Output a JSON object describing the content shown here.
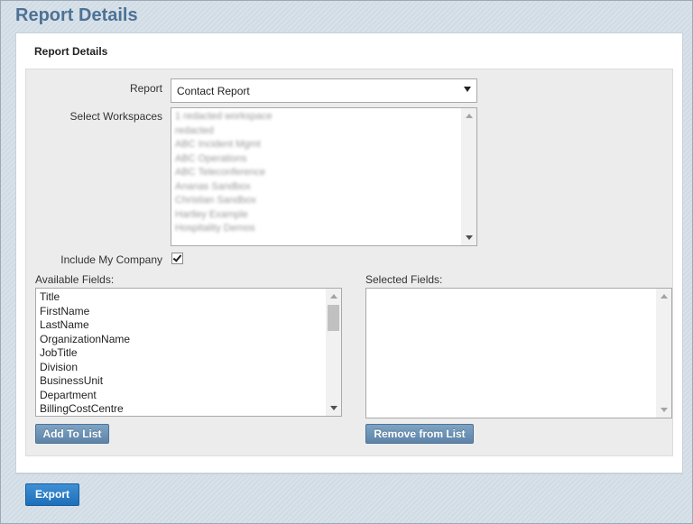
{
  "page": {
    "title": "Report Details"
  },
  "panel": {
    "title": "Report Details"
  },
  "form": {
    "report_label": "Report",
    "report_value": "Contact Report",
    "workspaces_label": "Select Workspaces",
    "workspaces_items": [
      "1 redacted workspace",
      "redacted",
      "ABC Incident Mgmt",
      "ABC Operations",
      "ABC Teleconference",
      "Ananas Sandbox",
      "Christian Sandbox",
      "Hartley Example",
      "Hospitality Demos"
    ],
    "include_company_label": "Include My Company",
    "include_company_checked": true
  },
  "available": {
    "label": "Available Fields:",
    "items": [
      "Title",
      "FirstName",
      "LastName",
      "OrganizationName",
      "JobTitle",
      "Division",
      "BusinessUnit",
      "Department",
      "BillingCostCentre"
    ],
    "add_button": "Add To List"
  },
  "selected": {
    "label": "Selected Fields:",
    "items": [],
    "remove_button": "Remove from List"
  },
  "footer": {
    "export_button": "Export"
  }
}
